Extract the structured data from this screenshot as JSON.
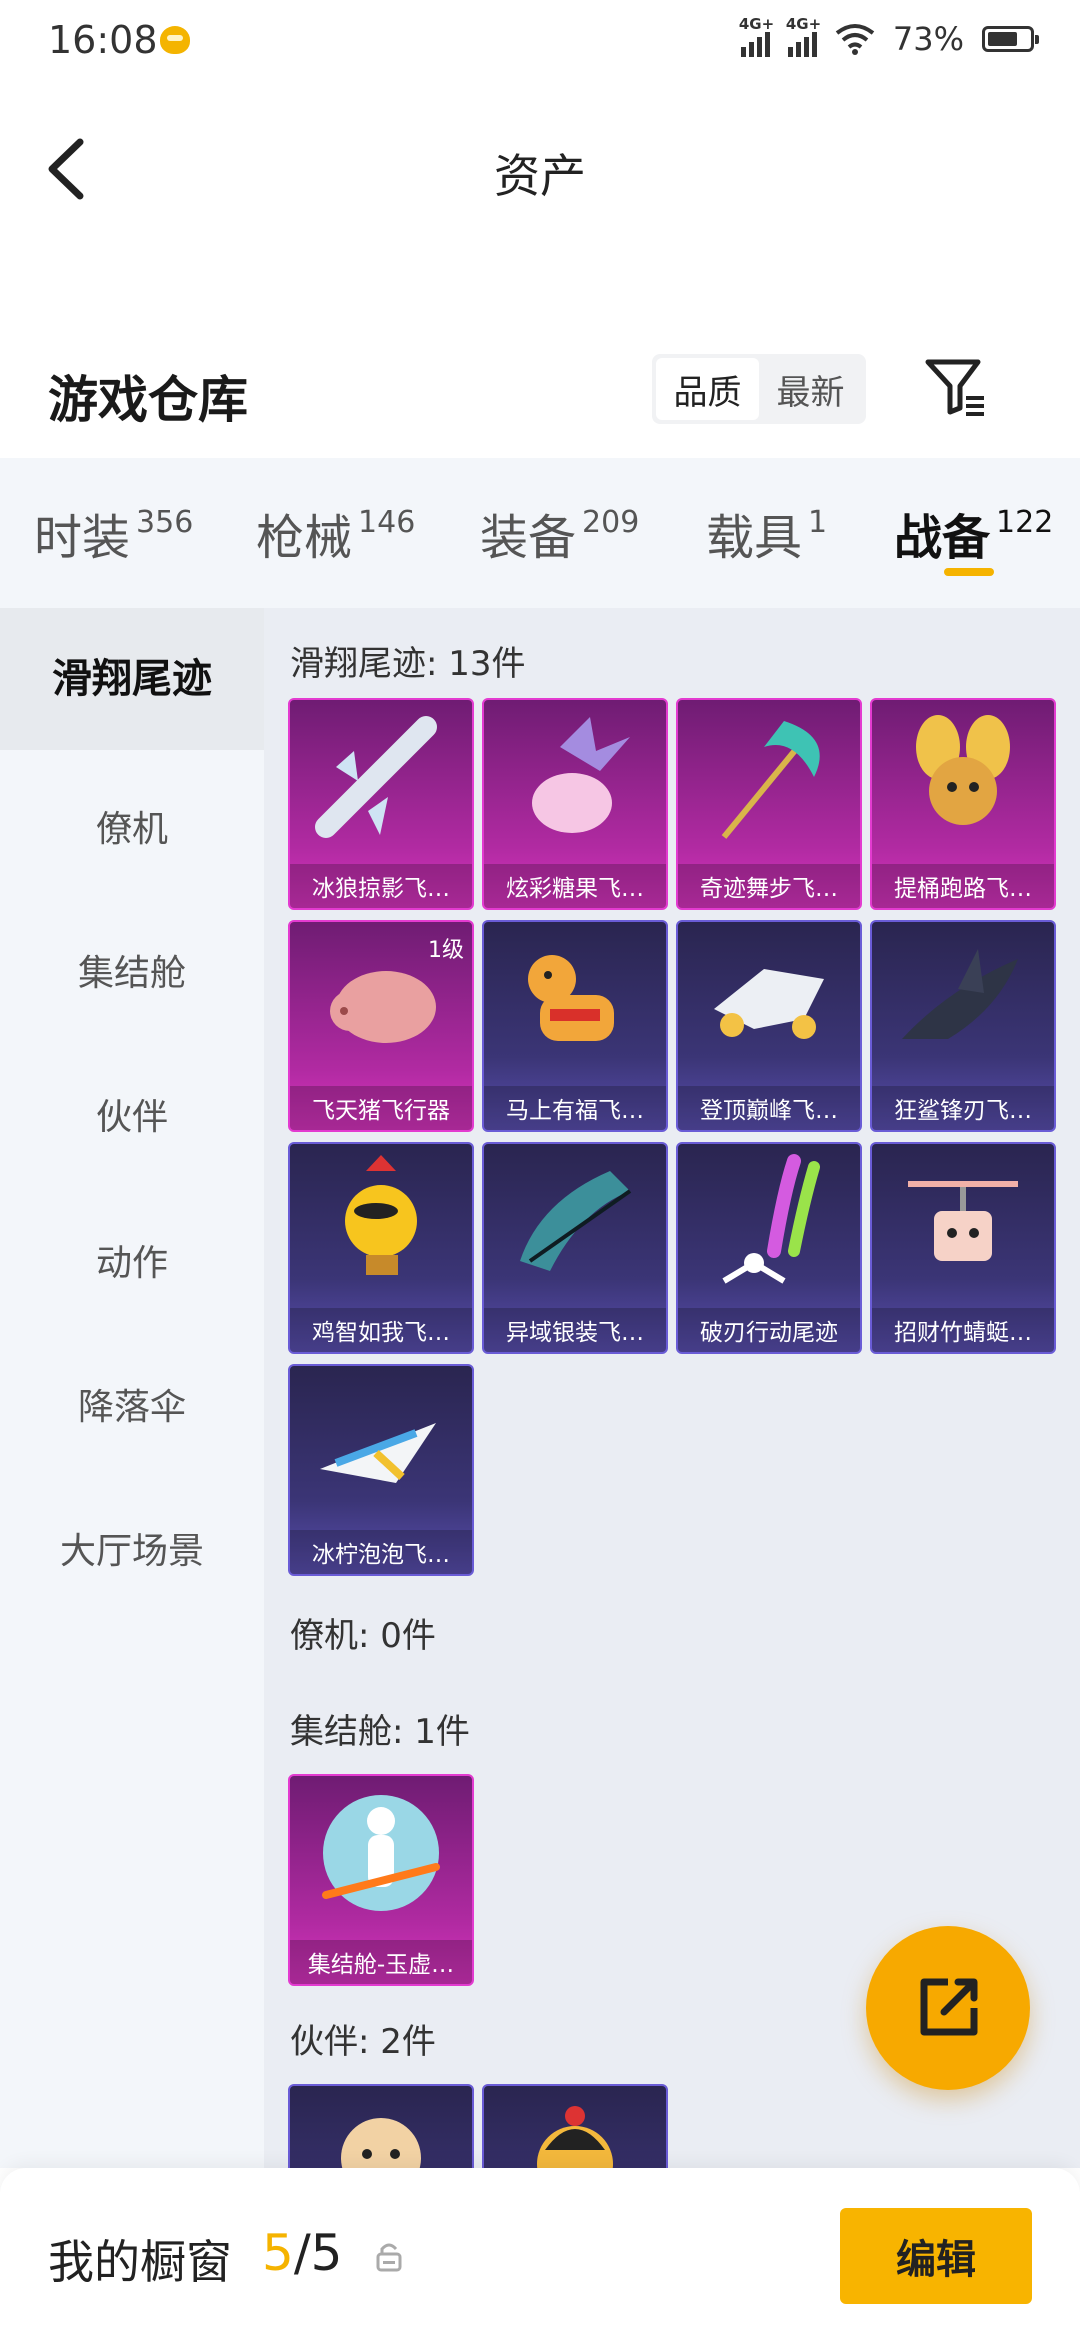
{
  "status": {
    "time": "16:08",
    "net1": "4G+",
    "net2": "4G+",
    "battery": "73%",
    "battery_level": 0.73
  },
  "header": {
    "title": "资产"
  },
  "warehouse": {
    "title": "游戏仓库",
    "sort_options": [
      "品质",
      "最新"
    ],
    "sort_selected": "品质"
  },
  "categories": [
    {
      "label": "时装",
      "count": "356"
    },
    {
      "label": "枪械",
      "count": "146"
    },
    {
      "label": "装备",
      "count": "209"
    },
    {
      "label": "载具",
      "count": "1"
    },
    {
      "label": "战备",
      "count": "122"
    }
  ],
  "active_category": "战备",
  "side_nav": [
    "滑翔尾迹",
    "僚机",
    "集结舱",
    "伙伴",
    "动作",
    "降落伞",
    "大厅场景"
  ],
  "sections": {
    "glide": {
      "title": "滑翔尾迹: 13件"
    },
    "wingman": {
      "title": "僚机: 0件"
    },
    "capsule": {
      "title": "集结舱: 1件"
    },
    "partner": {
      "title": "伙伴: 2件"
    }
  },
  "glide_items": [
    {
      "name": "冰狼掠影飞…",
      "rarity": "pink"
    },
    {
      "name": "炫彩糖果飞…",
      "rarity": "pink"
    },
    {
      "name": "奇迹舞步飞…",
      "rarity": "pink"
    },
    {
      "name": "提桶跑路飞…",
      "rarity": "pink"
    },
    {
      "name": "飞天猪飞行器",
      "rarity": "pink",
      "level": "1级"
    },
    {
      "name": "马上有福飞…",
      "rarity": "blue"
    },
    {
      "name": "登顶巅峰飞…",
      "rarity": "blue"
    },
    {
      "name": "狂鲨锋刃飞…",
      "rarity": "blue"
    },
    {
      "name": "鸡智如我飞…",
      "rarity": "blue"
    },
    {
      "name": "异域银装飞…",
      "rarity": "blue"
    },
    {
      "name": "破刃行动尾迹",
      "rarity": "blue"
    },
    {
      "name": "招财竹蜻蜓…",
      "rarity": "blue"
    },
    {
      "name": "冰柠泡泡飞…",
      "rarity": "blue"
    }
  ],
  "capsule_items": [
    {
      "name": "集结舱-玉虚…",
      "rarity": "pink"
    }
  ],
  "bottom_bar": {
    "label": "我的橱窗",
    "used": "5",
    "separator": "/",
    "total": "5",
    "edit_label": "编辑"
  },
  "colors": {
    "accent": "#f8b400",
    "pink_rarity": "#d734bf",
    "blue_rarity": "#5a4fb0"
  }
}
